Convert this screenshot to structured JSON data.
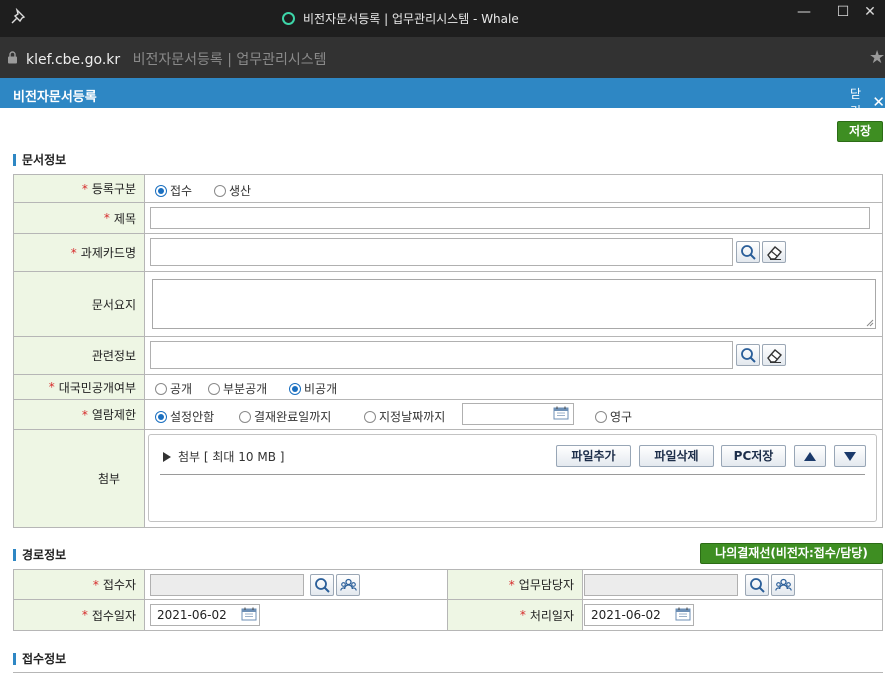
{
  "window": {
    "title": "비전자문서등록 | 업무관리시스템 - Whale",
    "minimize": "—",
    "maximize": "☐",
    "close": "✕"
  },
  "address": {
    "host": "klef.cbe.go.kr",
    "page_title": "비전자문서등록 | 업무관리시스템"
  },
  "popup": {
    "title": "비전자문서등록",
    "close_label": "닫기",
    "close_x": "✕"
  },
  "actions": {
    "save_label": "저장"
  },
  "doc_section": {
    "title": "문서정보",
    "required_mark": "*",
    "reg_type": {
      "label": "등록구분",
      "options": [
        "접수",
        "생산"
      ],
      "selected": "접수"
    },
    "subject": {
      "label": "제목",
      "value": ""
    },
    "task_card": {
      "label": "과제카드명",
      "value": ""
    },
    "summary": {
      "label": "문서요지",
      "value": ""
    },
    "related": {
      "label": "관련정보",
      "value": ""
    },
    "disclosure": {
      "label": "대국민공개여부",
      "options": [
        "공개",
        "부분공개",
        "비공개"
      ],
      "selected": "비공개"
    },
    "view_limit": {
      "label": "열람제한",
      "options": [
        "설정안함",
        "결재완료일까지",
        "지정날짜까지",
        "영구"
      ],
      "selected": "설정안함",
      "date_value": ""
    },
    "attach": {
      "label": "첨부",
      "header": "첨부 [ 최대 10 MB ]",
      "add_label": "파일추가",
      "delete_label": "파일삭제",
      "pc_save_label": "PC저장"
    }
  },
  "route_section": {
    "title": "경로정보",
    "my_approval_label": "나의결재선(비전자:접수/담당)",
    "receiver": {
      "label": "접수자",
      "value": ""
    },
    "handler": {
      "label": "업무담당자",
      "value": ""
    },
    "receive_date": {
      "label": "접수일자",
      "value": "2021-06-02"
    },
    "process_date": {
      "label": "처리일자",
      "value": "2021-06-02"
    }
  },
  "receipt_section": {
    "title": "접수정보"
  },
  "colors": {
    "header_blue": "#2e87c4",
    "label_bg": "#eef6e4",
    "green_button": "#3e8e22",
    "required_red": "#d62a2a"
  }
}
